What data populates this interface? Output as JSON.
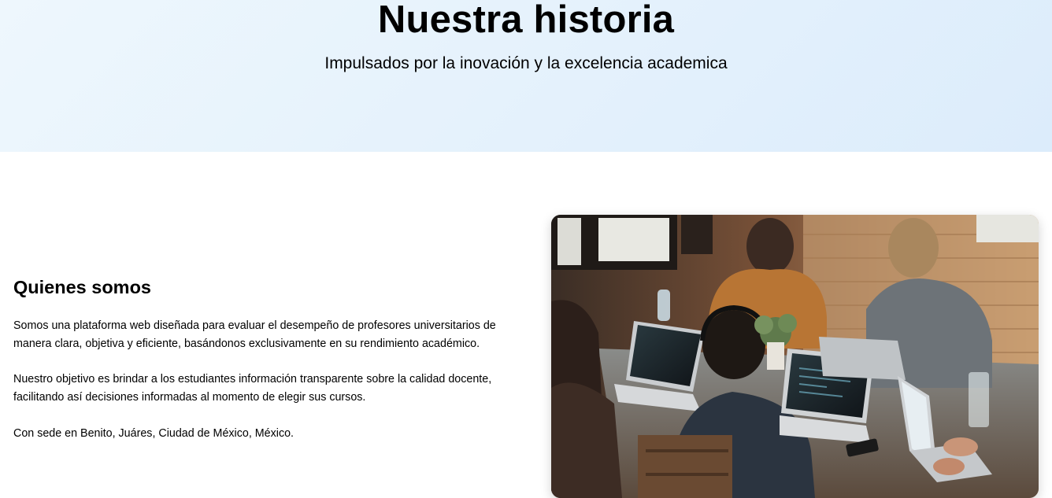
{
  "hero": {
    "title": "Nuestra historia",
    "subtitle": "Impulsados por la inovación y la excelencia academica"
  },
  "about": {
    "heading": "Quienes somos",
    "paragraphs": [
      "Somos una plataforma web diseñada para evaluar el desempeño de profesores universitarios de manera clara, objetiva y eficiente, basándonos exclusivamente en su rendimiento académico.",
      "Nuestro objetivo es brindar a los estudiantes información transparente sobre la calidad docente, facilitando así decisiones informadas al momento de elegir sus cursos.",
      "Con sede en Benito, Juáres, Ciudad de México, México."
    ]
  },
  "image": {
    "icon": "team-photo-icon"
  },
  "colors": {
    "hero_bg_start": "#eef7fd",
    "hero_bg_end": "#dcecfb",
    "text": "#000000"
  }
}
